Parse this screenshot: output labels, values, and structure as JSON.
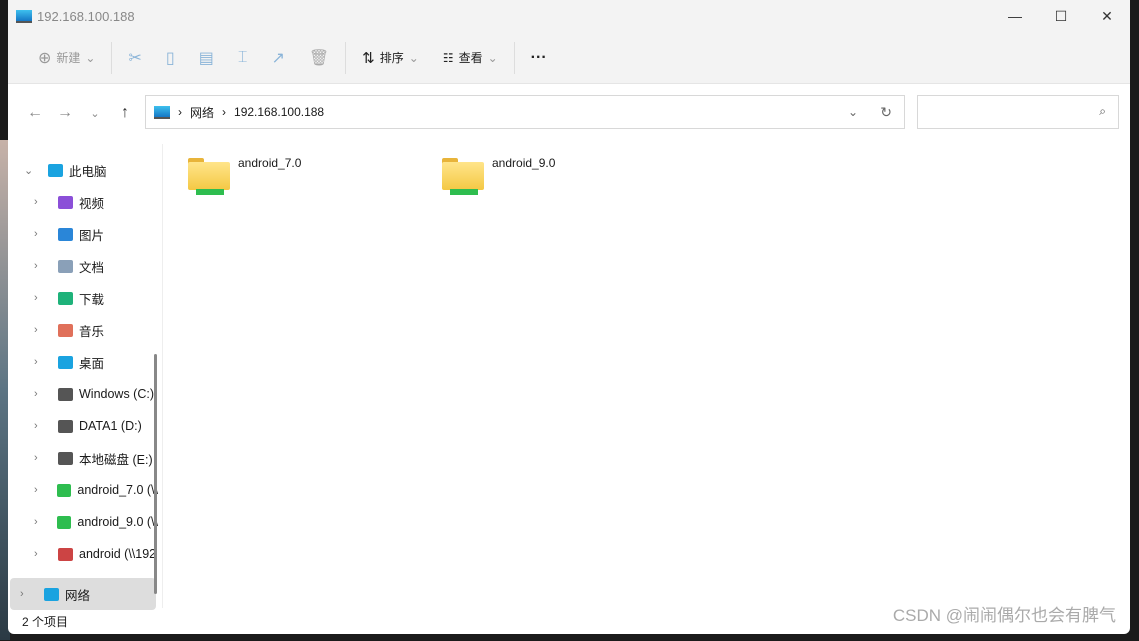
{
  "window": {
    "title": "192.168.100.188",
    "min": "—",
    "max": "☐",
    "close": "✕"
  },
  "toolbar": {
    "new": "新建",
    "sort": "排序",
    "view": "查看",
    "more": "···"
  },
  "nav": {
    "back": "←",
    "forward": "→",
    "recent": "⌄",
    "up": "↑"
  },
  "address": {
    "crumbs": [
      "网络",
      "192.168.100.188"
    ],
    "sep": "›",
    "dropdown": "⌄",
    "refresh": "↻"
  },
  "search": {
    "icon": "⌕"
  },
  "sidebar": {
    "items": [
      {
        "label": "此电脑",
        "chev": "⌄",
        "color": "#1aa3e0"
      },
      {
        "label": "视频",
        "chev": "›",
        "color": "#8b4fd8"
      },
      {
        "label": "图片",
        "chev": "›",
        "color": "#2a86d8"
      },
      {
        "label": "文档",
        "chev": "›",
        "color": "#8aa0b8"
      },
      {
        "label": "下载",
        "chev": "›",
        "color": "#1eb27a"
      },
      {
        "label": "音乐",
        "chev": "›",
        "color": "#e0705a"
      },
      {
        "label": "桌面",
        "chev": "›",
        "color": "#1aa3e0"
      },
      {
        "label": "Windows (C:)",
        "chev": "›",
        "color": "#555"
      },
      {
        "label": "DATA1 (D:)",
        "chev": "›",
        "color": "#555"
      },
      {
        "label": "本地磁盘 (E:)",
        "chev": "›",
        "color": "#555"
      },
      {
        "label": "android_7.0 (\\\\",
        "chev": "›",
        "color": "#2ebd4f"
      },
      {
        "label": "android_9.0 (\\\\",
        "chev": "›",
        "color": "#2ebd4f"
      },
      {
        "label": "android (\\\\192",
        "chev": "›",
        "color": "#c44"
      }
    ],
    "network": {
      "label": "网络",
      "chev": "›"
    }
  },
  "files": [
    {
      "name": "android_7.0"
    },
    {
      "name": "android_9.0"
    }
  ],
  "status": "2 个项目",
  "watermark": "CSDN @闹闹偶尔也会有脾气"
}
